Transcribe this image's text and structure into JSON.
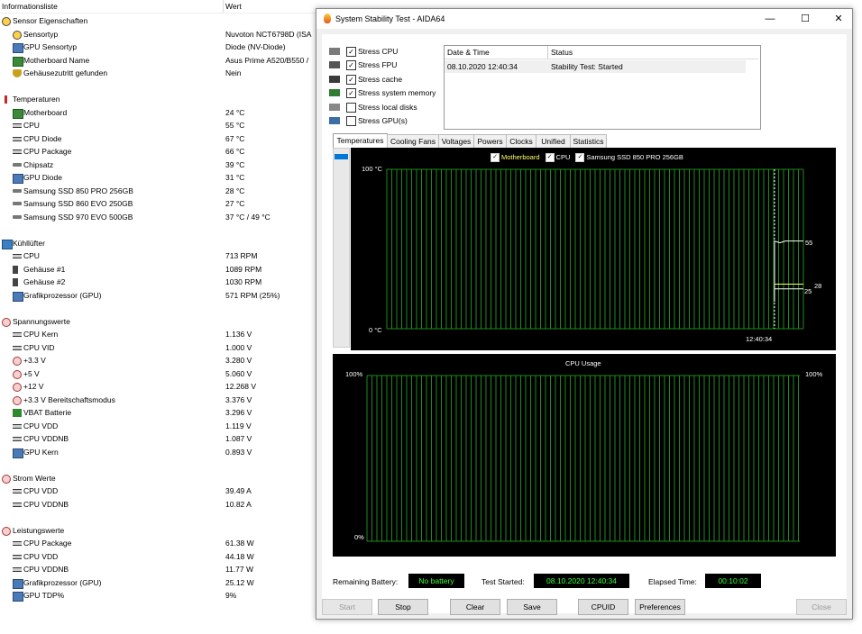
{
  "sensor": {
    "header": {
      "col1": "Informationsliste",
      "col2": "Wert"
    },
    "rows": [
      {
        "kind": "grp",
        "icon": "sensor-icon",
        "label": "Sensor Eigenschaften",
        "value": ""
      },
      {
        "kind": "itm",
        "icon": "sensor-type-icon",
        "label": "Sensortyp",
        "value": "Nuvoton NCT6798D  (ISA"
      },
      {
        "kind": "itm",
        "icon": "gpu-sensor-icon",
        "label": "GPU Sensortyp",
        "value": "Diode  (NV-Diode)"
      },
      {
        "kind": "itm",
        "icon": "motherboard-icon",
        "label": "Motherboard Name",
        "value": "Asus Prime A520/B550 /"
      },
      {
        "kind": "itm",
        "icon": "shield-icon",
        "label": "Gehäusezutritt gefunden",
        "value": "Nein"
      },
      {
        "kind": "gap"
      },
      {
        "kind": "grp",
        "icon": "thermometer-icon",
        "label": "Temperaturen",
        "value": ""
      },
      {
        "kind": "itm",
        "icon": "motherboard-icon",
        "label": "Motherboard",
        "value": "24 °C"
      },
      {
        "kind": "itm",
        "icon": "cpu-icon",
        "label": "CPU",
        "value": "55 °C"
      },
      {
        "kind": "itm",
        "icon": "cpu-icon",
        "label": "CPU Diode",
        "value": "67 °C"
      },
      {
        "kind": "itm",
        "icon": "cpu-icon",
        "label": "CPU Package",
        "value": "66 °C"
      },
      {
        "kind": "itm",
        "icon": "chipset-icon",
        "label": "Chipsatz",
        "value": "39 °C"
      },
      {
        "kind": "itm",
        "icon": "gpu-icon",
        "label": "GPU Diode",
        "value": "31 °C"
      },
      {
        "kind": "itm",
        "icon": "drive-icon",
        "label": "Samsung SSD 850 PRO 256GB",
        "value": "28 °C"
      },
      {
        "kind": "itm",
        "icon": "drive-icon",
        "label": "Samsung SSD 860 EVO 250GB",
        "value": "27 °C"
      },
      {
        "kind": "itm",
        "icon": "drive-icon",
        "label": "Samsung SSD 970 EVO 500GB",
        "value": "37 °C / 49 °C"
      },
      {
        "kind": "gap"
      },
      {
        "kind": "grp",
        "icon": "fan-icon",
        "label": "Kühllüfter",
        "value": ""
      },
      {
        "kind": "itm",
        "icon": "cpu-icon",
        "label": "CPU",
        "value": "713 RPM"
      },
      {
        "kind": "itm",
        "icon": "case-icon",
        "label": "Gehäuse #1",
        "value": "1089 RPM"
      },
      {
        "kind": "itm",
        "icon": "case-icon",
        "label": "Gehäuse #2",
        "value": "1030 RPM"
      },
      {
        "kind": "itm",
        "icon": "gpu-icon",
        "label": "Grafikprozessor (GPU)",
        "value": "571 RPM  (25%)"
      },
      {
        "kind": "gap"
      },
      {
        "kind": "grp",
        "icon": "voltage-icon",
        "label": "Spannungswerte",
        "value": ""
      },
      {
        "kind": "itm",
        "icon": "cpu-icon",
        "label": "CPU Kern",
        "value": "1.136 V"
      },
      {
        "kind": "itm",
        "icon": "cpu-icon",
        "label": "CPU VID",
        "value": "1.000 V"
      },
      {
        "kind": "itm",
        "icon": "voltage-icon",
        "label": "+3.3 V",
        "value": "3.280 V"
      },
      {
        "kind": "itm",
        "icon": "voltage-icon",
        "label": "+5 V",
        "value": "5.060 V"
      },
      {
        "kind": "itm",
        "icon": "voltage-icon",
        "label": "+12 V",
        "value": "12.268 V"
      },
      {
        "kind": "itm",
        "icon": "voltage-icon",
        "label": "+3.3 V Bereitschaftsmodus",
        "value": "3.376 V"
      },
      {
        "kind": "itm",
        "icon": "battery-icon",
        "label": "VBAT Batterie",
        "value": "3.296 V"
      },
      {
        "kind": "itm",
        "icon": "cpu-icon",
        "label": "CPU VDD",
        "value": "1.119 V"
      },
      {
        "kind": "itm",
        "icon": "cpu-icon",
        "label": "CPU VDDNB",
        "value": "1.087 V"
      },
      {
        "kind": "itm",
        "icon": "gpu-icon",
        "label": "GPU Kern",
        "value": "0.893 V"
      },
      {
        "kind": "gap"
      },
      {
        "kind": "grp",
        "icon": "current-icon",
        "label": "Strom Werte",
        "value": ""
      },
      {
        "kind": "itm",
        "icon": "cpu-icon",
        "label": "CPU VDD",
        "value": "39.49 A"
      },
      {
        "kind": "itm",
        "icon": "cpu-icon",
        "label": "CPU VDDNB",
        "value": "10.82 A"
      },
      {
        "kind": "gap"
      },
      {
        "kind": "grp",
        "icon": "power-icon",
        "label": "Leistungswerte",
        "value": ""
      },
      {
        "kind": "itm",
        "icon": "cpu-icon",
        "label": "CPU Package",
        "value": "61.38 W"
      },
      {
        "kind": "itm",
        "icon": "cpu-icon",
        "label": "CPU VDD",
        "value": "44.18 W"
      },
      {
        "kind": "itm",
        "icon": "cpu-icon",
        "label": "CPU VDDNB",
        "value": "11.77 W"
      },
      {
        "kind": "itm",
        "icon": "gpu-icon",
        "label": "Grafikprozessor (GPU)",
        "value": "25.12 W"
      },
      {
        "kind": "itm",
        "icon": "gpu-icon",
        "label": "GPU TDP%",
        "value": "9%"
      }
    ]
  },
  "dialog": {
    "title": "System Stability Test - AIDA64",
    "window_buttons": {
      "minimize": "—",
      "maximize": "☐",
      "close": "✕"
    },
    "stress_options": [
      {
        "label": "Stress CPU",
        "checked": true,
        "icon": "cpu-icon"
      },
      {
        "label": "Stress FPU",
        "checked": true,
        "icon": "fpu-icon"
      },
      {
        "label": "Stress cache",
        "checked": true,
        "icon": "cache-icon"
      },
      {
        "label": "Stress system memory",
        "checked": true,
        "icon": "memory-icon"
      },
      {
        "label": "Stress local disks",
        "checked": false,
        "icon": "disk-icon"
      },
      {
        "label": "Stress GPU(s)",
        "checked": false,
        "icon": "gpu-icon"
      }
    ],
    "status_table": {
      "headers": [
        "Date & Time",
        "Status"
      ],
      "rows": [
        [
          "08.10.2020 12:40:34",
          "Stability Test: Started"
        ]
      ]
    },
    "tabs": [
      "Temperatures",
      "Cooling Fans",
      "Voltages",
      "Powers",
      "Clocks",
      "Unified",
      "Statistics"
    ],
    "active_tab": "Temperatures",
    "check_mark": "✓",
    "temp_graph": {
      "legend": [
        {
          "label": "Motherboard",
          "checked": true,
          "color": "#ffff66"
        },
        {
          "label": "CPU",
          "checked": true,
          "color": "#ffffff"
        },
        {
          "label": "Samsung SSD 850 PRO 256GB",
          "checked": true,
          "color": "#ffffff"
        }
      ],
      "y_top_label": "100 °C",
      "y_bottom_label": "0 °C",
      "x_label": "12:40:34",
      "value_labels": {
        "cpu": "55",
        "ssd": "25",
        "motherboard": "28"
      },
      "grid_color": "#1e8a1e",
      "line_color": "#ffffff"
    },
    "cpu_graph": {
      "title": "CPU Usage",
      "y_top_left": "100%",
      "y_top_right": "100%",
      "y_bottom_left": "0%",
      "grid_color": "#1e8a1e"
    },
    "bottom": {
      "remaining_battery_label": "Remaining Battery:",
      "remaining_battery_value": "No battery",
      "test_started_label": "Test Started:",
      "test_started_value": "08.10.2020 12:40:34",
      "elapsed_label": "Elapsed Time:",
      "elapsed_value": "00:10:02"
    },
    "buttons": {
      "start": "Start",
      "stop": "Stop",
      "clear": "Clear",
      "save": "Save",
      "cpuid": "CPUID",
      "preferences": "Preferences",
      "close": "Close"
    }
  }
}
